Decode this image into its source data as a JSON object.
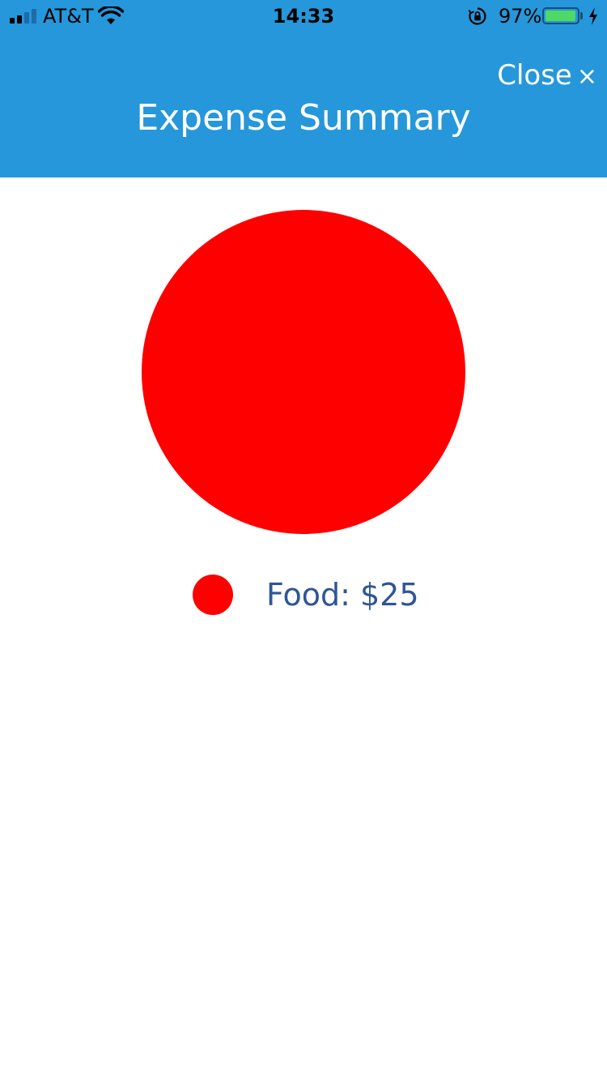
{
  "status_bar": {
    "carrier": "AT&T",
    "time": "14:33",
    "battery_percent": "97%",
    "battery_level": 0.97,
    "signal_bars_active": 2,
    "signal_bars_total": 4,
    "icons": [
      "signal-icon",
      "wifi-icon",
      "orientation-lock-icon",
      "battery-icon",
      "charging-icon"
    ]
  },
  "nav": {
    "title": "Expense Summary",
    "close_label": "Close",
    "close_glyph": "×",
    "background_color": "#2697da"
  },
  "legend": {
    "items": [
      {
        "label": "Food: $25",
        "color": "#ff0000"
      }
    ],
    "text_color": "#2f5597"
  },
  "chart_data": {
    "type": "pie",
    "categories": [
      "Food"
    ],
    "values": [
      25
    ],
    "colors": [
      "#ff0000"
    ]
  }
}
